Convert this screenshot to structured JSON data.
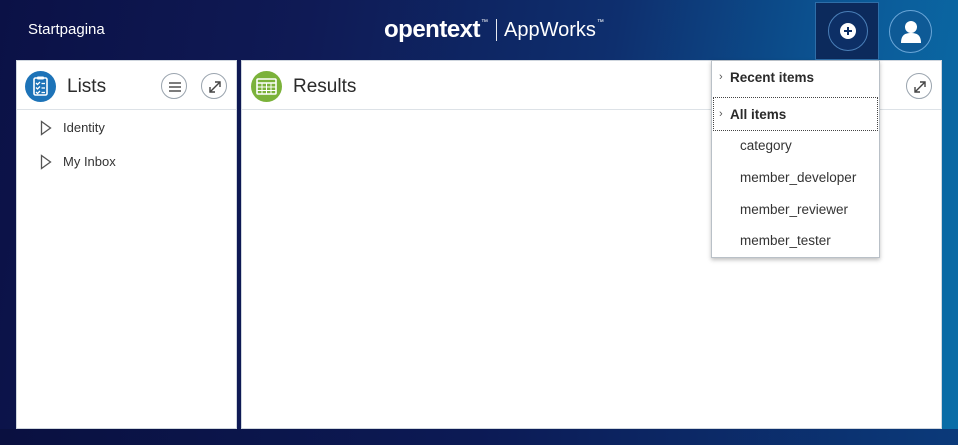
{
  "header": {
    "home_label": "Startpagina",
    "brand": {
      "name": "opentext",
      "trademark": "™",
      "product": "AppWorks",
      "product_trademark": "™"
    },
    "create_icon": "plus-circle-icon",
    "user_icon": "user-icon"
  },
  "lists_panel": {
    "title": "Lists",
    "icon": "checklist-icon",
    "tree": [
      {
        "label": "Identity"
      },
      {
        "label": "My Inbox"
      }
    ]
  },
  "results_panel": {
    "title": "Results",
    "icon": "table-icon"
  },
  "create_menu": {
    "recent_label": "Recent items",
    "all_label": "All items",
    "items": [
      "category",
      "member_developer",
      "member_reviewer",
      "member_tester"
    ]
  },
  "colors": {
    "header_bg_start": "#0b1146",
    "header_bg_end": "#0a6ea8",
    "lists_icon": "#1d73b8",
    "results_icon": "#7bb23a"
  }
}
